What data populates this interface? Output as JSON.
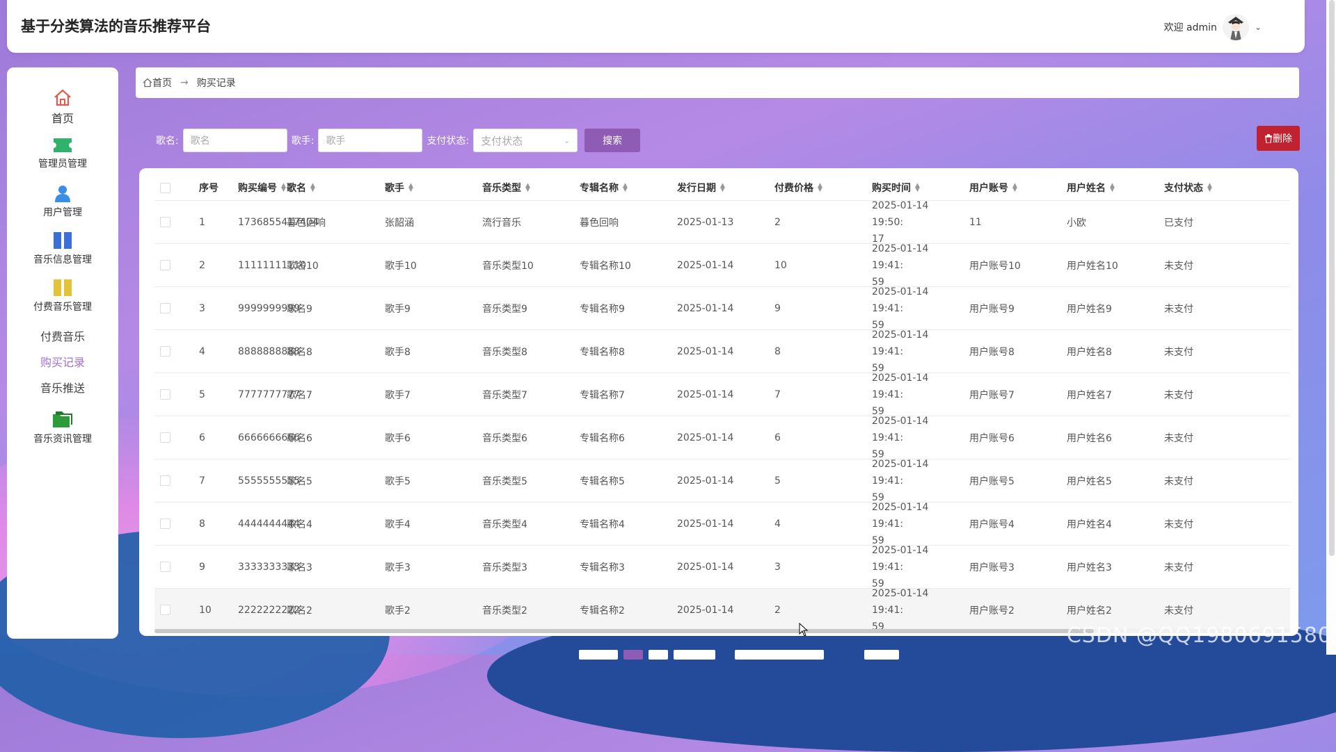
{
  "app": {
    "title": "基于分类算法的音乐推荐平台",
    "welcome": "欢迎 admin"
  },
  "sidebar": {
    "items": [
      {
        "label": "首页",
        "icon": "home-icon"
      },
      {
        "label": "管理员管理",
        "icon": "ticket-icon"
      },
      {
        "label": "用户管理",
        "icon": "user-icon"
      },
      {
        "label": "音乐信息管理",
        "icon": "book-icon"
      },
      {
        "label": "付费音乐管理",
        "icon": "folder-icon"
      },
      {
        "label": "付费音乐"
      },
      {
        "label": "购买记录"
      },
      {
        "label": "音乐推送"
      },
      {
        "label": "音乐资讯管理",
        "icon": "folders-icon"
      }
    ]
  },
  "breadcrumb": {
    "home": "首页",
    "arrow": "→",
    "current": "购买记录"
  },
  "search": {
    "song_label": "歌名:",
    "song_placeholder": "歌名",
    "singer_label": "歌手:",
    "singer_placeholder": "歌手",
    "status_label": "支付状态:",
    "status_placeholder": "支付状态",
    "search_button": "搜索",
    "delete_button": "删除"
  },
  "table": {
    "headers": [
      "序号",
      "购买编号",
      "歌名",
      "歌手",
      "音乐类型",
      "专辑名称",
      "发行日期",
      "付费价格",
      "购买时间",
      "用户账号",
      "用户姓名",
      "支付状态"
    ],
    "rows": [
      {
        "idx": "1",
        "order": "1736855417404",
        "song": "暮色回响",
        "singer": "张韶涵",
        "type": "流行音乐",
        "album": "暮色回响",
        "date": "2025-01-13",
        "price": "2",
        "time_a": "2025-01-14 19:50:",
        "time_b": "17",
        "account": "11",
        "name": "小欧",
        "status": "已支付"
      },
      {
        "idx": "2",
        "order": "11111111110",
        "song": "歌名10",
        "singer": "歌手10",
        "type": "音乐类型10",
        "album": "专辑名称10",
        "date": "2025-01-14",
        "price": "10",
        "time_a": "2025-01-14 19:41:",
        "time_b": "59",
        "account": "用户账号10",
        "name": "用户姓名10",
        "status": "未支付"
      },
      {
        "idx": "3",
        "order": "9999999999",
        "song": "歌名9",
        "singer": "歌手9",
        "type": "音乐类型9",
        "album": "专辑名称9",
        "date": "2025-01-14",
        "price": "9",
        "time_a": "2025-01-14 19:41:",
        "time_b": "59",
        "account": "用户账号9",
        "name": "用户姓名9",
        "status": "未支付"
      },
      {
        "idx": "4",
        "order": "8888888888",
        "song": "歌名8",
        "singer": "歌手8",
        "type": "音乐类型8",
        "album": "专辑名称8",
        "date": "2025-01-14",
        "price": "8",
        "time_a": "2025-01-14 19:41:",
        "time_b": "59",
        "account": "用户账号8",
        "name": "用户姓名8",
        "status": "未支付"
      },
      {
        "idx": "5",
        "order": "7777777777",
        "song": "歌名7",
        "singer": "歌手7",
        "type": "音乐类型7",
        "album": "专辑名称7",
        "date": "2025-01-14",
        "price": "7",
        "time_a": "2025-01-14 19:41:",
        "time_b": "59",
        "account": "用户账号7",
        "name": "用户姓名7",
        "status": "未支付"
      },
      {
        "idx": "6",
        "order": "6666666666",
        "song": "歌名6",
        "singer": "歌手6",
        "type": "音乐类型6",
        "album": "专辑名称6",
        "date": "2025-01-14",
        "price": "6",
        "time_a": "2025-01-14 19:41:",
        "time_b": "59",
        "account": "用户账号6",
        "name": "用户姓名6",
        "status": "未支付"
      },
      {
        "idx": "7",
        "order": "5555555555",
        "song": "歌名5",
        "singer": "歌手5",
        "type": "音乐类型5",
        "album": "专辑名称5",
        "date": "2025-01-14",
        "price": "5",
        "time_a": "2025-01-14 19:41:",
        "time_b": "59",
        "account": "用户账号5",
        "name": "用户姓名5",
        "status": "未支付"
      },
      {
        "idx": "8",
        "order": "4444444444",
        "song": "歌名4",
        "singer": "歌手4",
        "type": "音乐类型4",
        "album": "专辑名称4",
        "date": "2025-01-14",
        "price": "4",
        "time_a": "2025-01-14 19:41:",
        "time_b": "59",
        "account": "用户账号4",
        "name": "用户姓名4",
        "status": "未支付"
      },
      {
        "idx": "9",
        "order": "3333333333",
        "song": "歌名3",
        "singer": "歌手3",
        "type": "音乐类型3",
        "album": "专辑名称3",
        "date": "2025-01-14",
        "price": "3",
        "time_a": "2025-01-14 19:41:",
        "time_b": "59",
        "account": "用户账号3",
        "name": "用户姓名3",
        "status": "未支付"
      },
      {
        "idx": "10",
        "order": "2222222222",
        "song": "歌名2",
        "singer": "歌手2",
        "type": "音乐类型2",
        "album": "专辑名称2",
        "date": "2025-01-14",
        "price": "2",
        "time_a": "2025-01-14 19:41:",
        "time_b": "59",
        "account": "用户账号2",
        "name": "用户姓名2",
        "status": "未支付"
      }
    ]
  },
  "watermark": "CSDN @QQ1980691580",
  "colors": {
    "accent_purple": "#8e5bb5",
    "active_nav": "#a16fd9",
    "delete_red": "#c0232f",
    "home_icon": "#e05a4f",
    "ticket_icon": "#2fb36a",
    "user_icon": "#3a8ee6",
    "book_icon": "#3b6fd8",
    "folder_icon": "#e3c33a",
    "folders_icon": "#2e9b3a"
  }
}
